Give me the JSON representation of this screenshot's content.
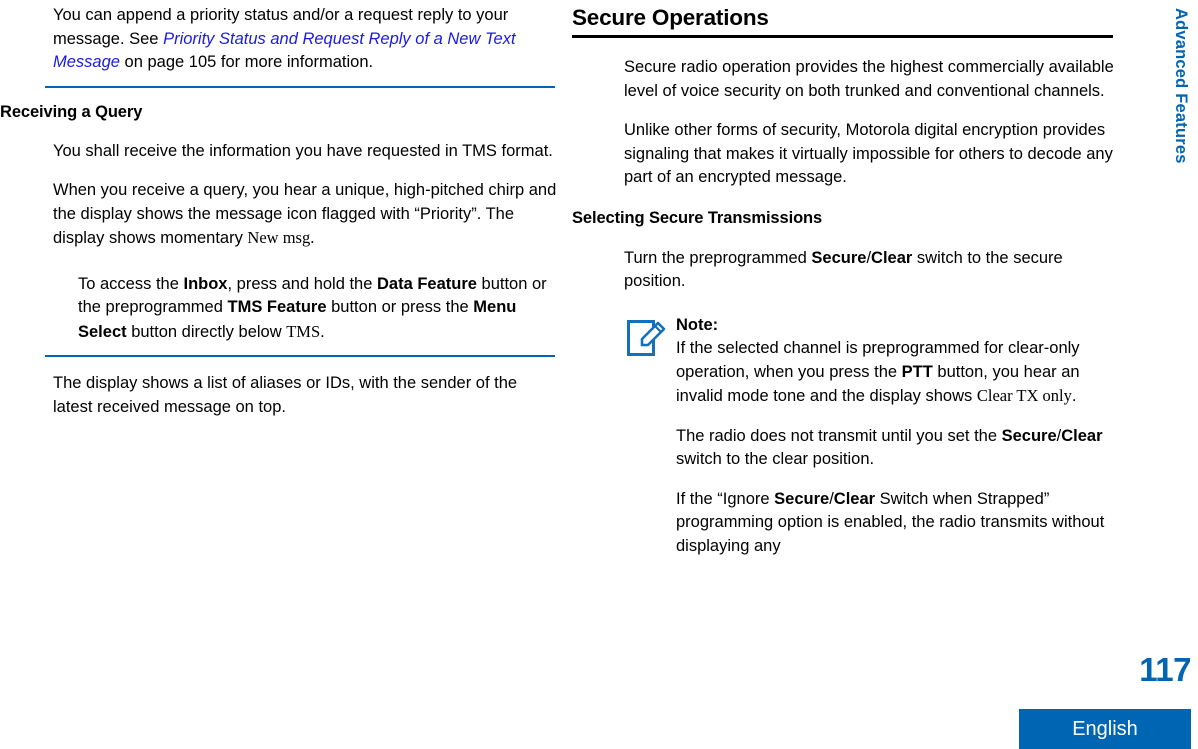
{
  "colors": {
    "rule_blue": "#0066b3",
    "xref_blue": "#1a1ae6",
    "badge_blue": "#0066b3",
    "rule_black": "#000000"
  },
  "left_column": {
    "intro_paragraph": {
      "part1": "You can append a priority status and/or a request reply to your message. See ",
      "xref": "Priority Status and Request Reply of a New Text Message",
      "part2": " on page 105 for more information."
    },
    "heading_receiving_query": "Receiving a Query",
    "para_tms_format": "You shall receive the information you have requested in TMS format.",
    "para_query_chirp": {
      "part1": "When you receive a query, you hear a unique, high-pitched chirp and the display shows the message icon flagged with “Priority”. The display shows momentary ",
      "display": "New msg."
    },
    "para_access_inbox": {
      "p1": "To access the ",
      "b1": "Inbox",
      "p2": ", press and hold the ",
      "b2": "Data Feature",
      "p3": " button or the preprogrammed ",
      "b3": "TMS Feature",
      "p4": " button or press the ",
      "b4": "Menu Select",
      "p5": " button directly below ",
      "display": "TMS",
      "p6": "."
    },
    "para_alias_list": "The display shows a list of aliases or IDs, with the sender of the latest received message on top."
  },
  "right_column": {
    "heading_secure_operations": "Secure Operations",
    "para_secure_radio": "Secure radio operation provides the highest commercially available level of voice security on both trunked and conventional channels.",
    "para_unlike_other": "Unlike other forms of security, Motorola digital encryption provides signaling that makes it virtually impossible for others to decode any part of an encrypted message.",
    "heading_selecting_secure": "Selecting Secure Transmissions",
    "para_turn_switch": {
      "p1": "Turn the preprogrammed ",
      "b1": "Secure",
      "p2": "/",
      "b2": "Clear",
      "p3": " switch to the secure position."
    },
    "note": {
      "icon": "note-pencil-icon",
      "title": "Note:",
      "para_clear_only": {
        "p1": "If the selected channel is preprogrammed for clear-only operation, when you press the ",
        "b1": "PTT",
        "p2": " button, you hear an invalid mode tone and the display shows ",
        "display": "Clear TX only",
        "p3": "."
      },
      "para_no_transmit": {
        "p1": "The radio does not transmit until you set the ",
        "b1": "Secure",
        "p2": "/",
        "b2": "Clear",
        "p3": " switch to the clear position."
      },
      "para_ignore_strapped": {
        "p1": "If the “Ignore ",
        "b1": "Secure",
        "p2": "/",
        "b2": "Clear",
        "p3": " Switch when Strapped” programming option is enabled, the radio transmits without displaying any"
      }
    }
  },
  "side_tab": {
    "label": "Advanced Features"
  },
  "footer": {
    "page_number": "117",
    "language": "English"
  }
}
